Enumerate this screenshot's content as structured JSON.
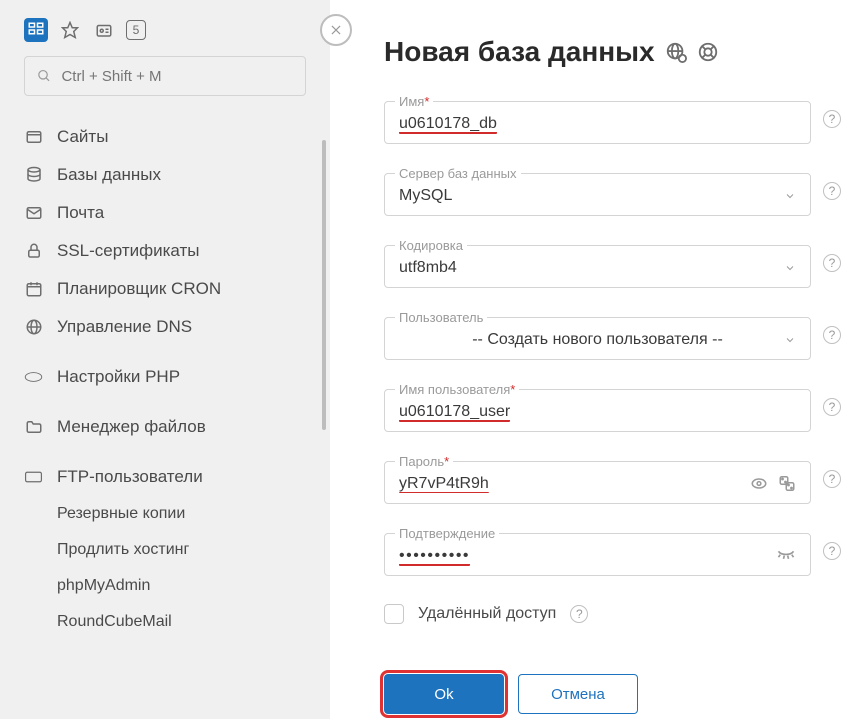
{
  "search": {
    "placeholder": "Ctrl + Shift + M"
  },
  "nav": {
    "sites": "Сайты",
    "databases": "Базы данных",
    "mail": "Почта",
    "ssl": "SSL-сертификаты",
    "cron": "Планировщик CRON",
    "dns": "Управление DNS",
    "php": "Настройки PHP",
    "files": "Менеджер файлов",
    "ftp": "FTP-пользователи",
    "backups": "Резервные копии",
    "extend": "Продлить хостинг",
    "phpmyadmin": "phpMyAdmin",
    "roundcube": "RoundCubeMail"
  },
  "page": {
    "title": "Новая база данных"
  },
  "form": {
    "name_label": "Имя",
    "name_value": "u0610178_db",
    "server_label": "Сервер баз данных",
    "server_value": "MySQL",
    "encoding_label": "Кодировка",
    "encoding_value": "utf8mb4",
    "user_label": "Пользователь",
    "user_value": "-- Создать нового пользователя --",
    "username_label": "Имя пользователя",
    "username_value": "u0610178_user",
    "password_label": "Пароль",
    "password_value": "yR7vP4tR9h",
    "confirm_label": "Подтверждение",
    "confirm_value": "••••••••••",
    "remote_label": "Удалённый доступ"
  },
  "buttons": {
    "ok": "Ok",
    "cancel": "Отмена"
  },
  "sidebar_badge": "5"
}
